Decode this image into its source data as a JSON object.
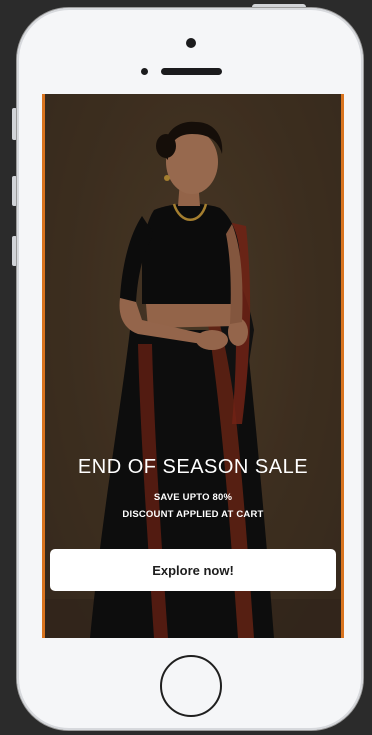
{
  "promo": {
    "title": "END OF SEASON SALE",
    "subtitle_line1": "SAVE UPTO 80%",
    "subtitle_line2": "DISCOUNT APPLIED AT CART",
    "cta_label": "Explore now!"
  },
  "colors": {
    "background": "#2b2b2b",
    "phone_body": "#f5f6f8",
    "screen_accent": "#d9741f",
    "saree_black": "#111111",
    "saree_border": "#8a2a1a",
    "cta_background": "#ffffff"
  },
  "icons": {
    "camera": "camera-icon",
    "home": "home-button-icon"
  }
}
